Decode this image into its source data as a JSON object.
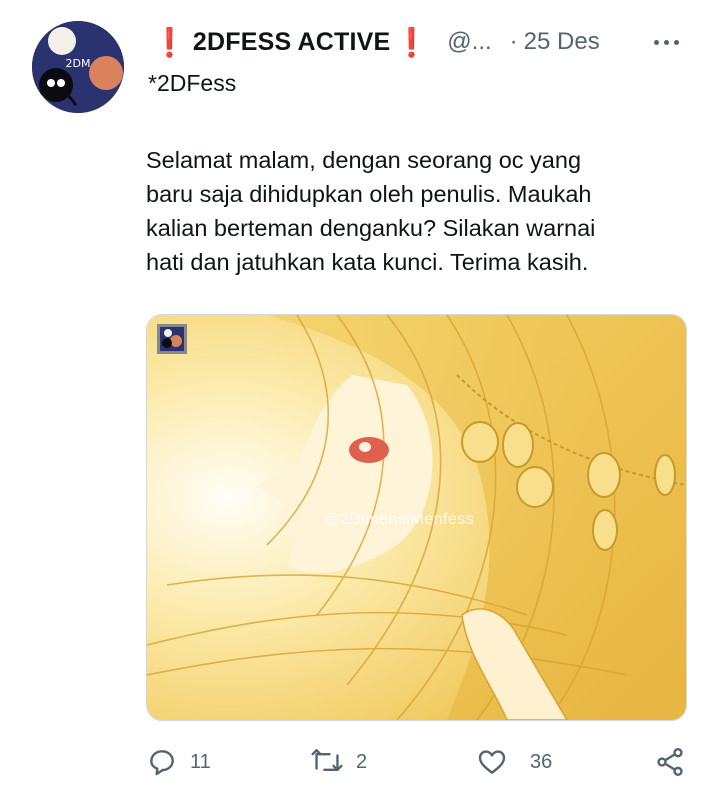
{
  "tweet": {
    "display_name": "2DFESS ACTIVE",
    "name_emoji": "❗",
    "handle": "@...",
    "dot": "·",
    "date": "25 Des",
    "subtitle": "*2DFess",
    "text_lines": [
      "Selamat malam, dengan seorang oc yang",
      "baru saja dihidupkan oleh penulis. Maukah",
      "kalian berteman denganku? Silakan warnai",
      "hati dan jatuhkan kata kunci. Terima kasih."
    ],
    "image_watermark": "@2DimensiMenfess",
    "avatar_text": "2DM"
  },
  "actions": {
    "reply_count": "11",
    "retweet_count": "2",
    "like_count": "36"
  },
  "icons": {
    "more": "more-horizontal-icon",
    "reply": "reply-icon",
    "retweet": "retweet-icon",
    "like": "heart-icon",
    "share": "share-icon"
  },
  "colors": {
    "accent_red": "#dd2e44",
    "muted_text": "#536471",
    "avatar_bg": "#2b3270"
  }
}
